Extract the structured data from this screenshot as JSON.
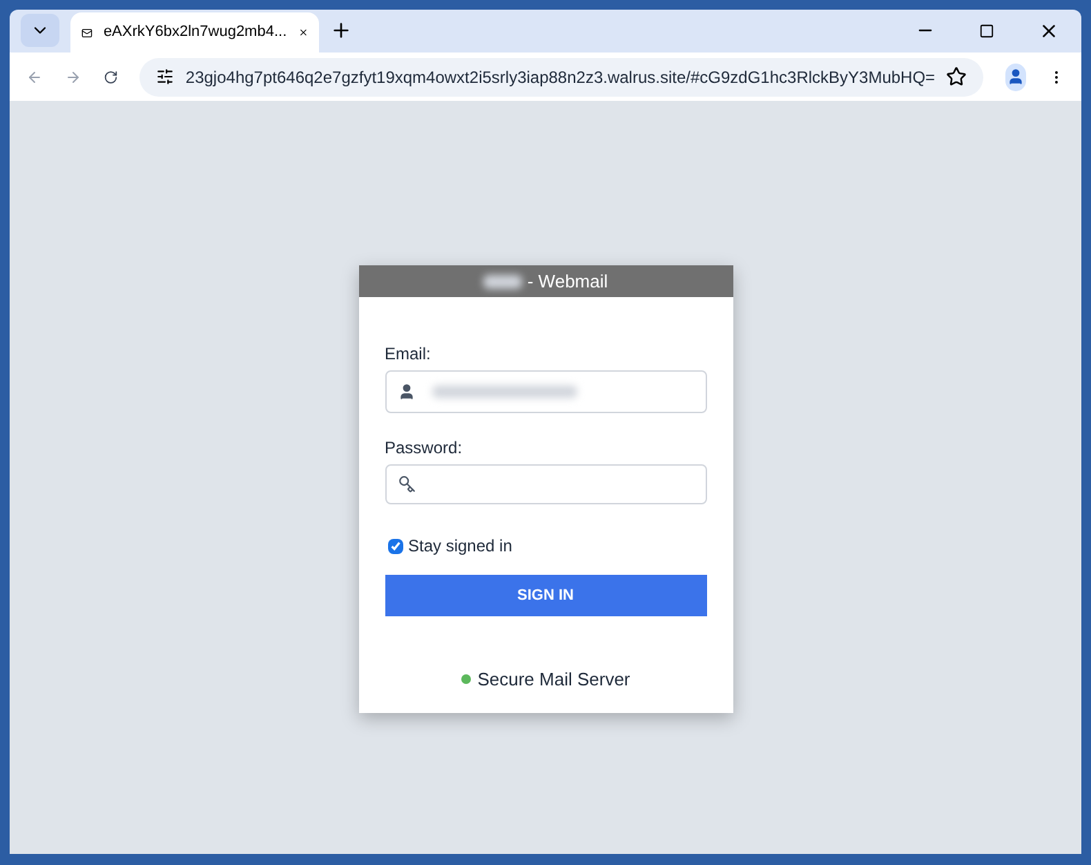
{
  "browser": {
    "tab": {
      "title": "eAXrkY6bx2ln7wug2mb4...",
      "selected": true
    },
    "address": "23gjo4hg7pt646q2e7gzfyt19xqm4owxt2i5srly3iap88n2z3.walrus.site/#cG9zdG1hc3RlckByY3MubHQ="
  },
  "login": {
    "title": "- Webmail",
    "email_label": "Email:",
    "password_label": "Password:",
    "stay_signed_in": {
      "label": "Stay signed in",
      "checked": true
    },
    "button": "SIGN IN",
    "footer": {
      "text": "Secure Mail Server",
      "color": "#5cb85c"
    }
  }
}
